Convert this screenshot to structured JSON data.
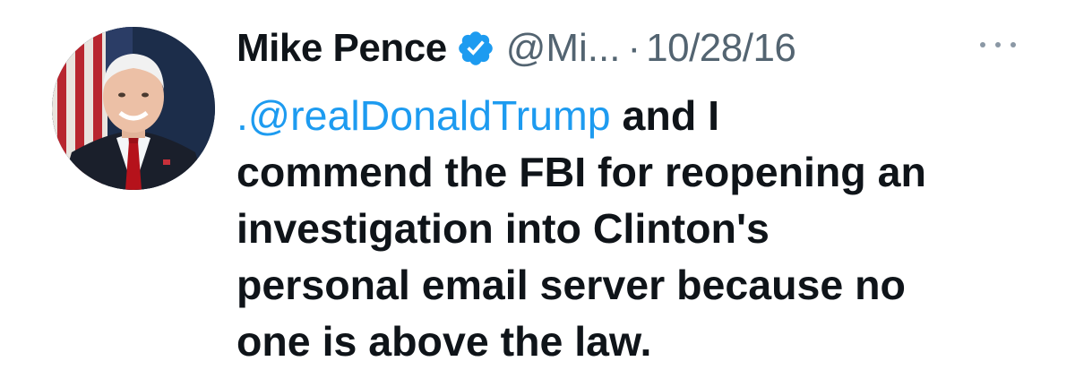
{
  "tweet": {
    "author": {
      "display_name": "Mike Pence",
      "handle": "@Mi...",
      "verified": true,
      "avatar_icon": "profile-photo"
    },
    "separator": "·",
    "date": "10/28/16",
    "more_icon": "more-options-icon",
    "text_lines": [
      {
        "mention": ".@realDonaldTrump",
        "rest": " and I"
      },
      {
        "rest": "commend the FBI for reopening an"
      },
      {
        "rest": "investigation into Clinton's"
      },
      {
        "rest": "personal email server because no"
      },
      {
        "rest": "one is above the law."
      }
    ]
  },
  "colors": {
    "text": "#0f1419",
    "secondary_text": "#536471",
    "accent": "#1d9bf0"
  }
}
